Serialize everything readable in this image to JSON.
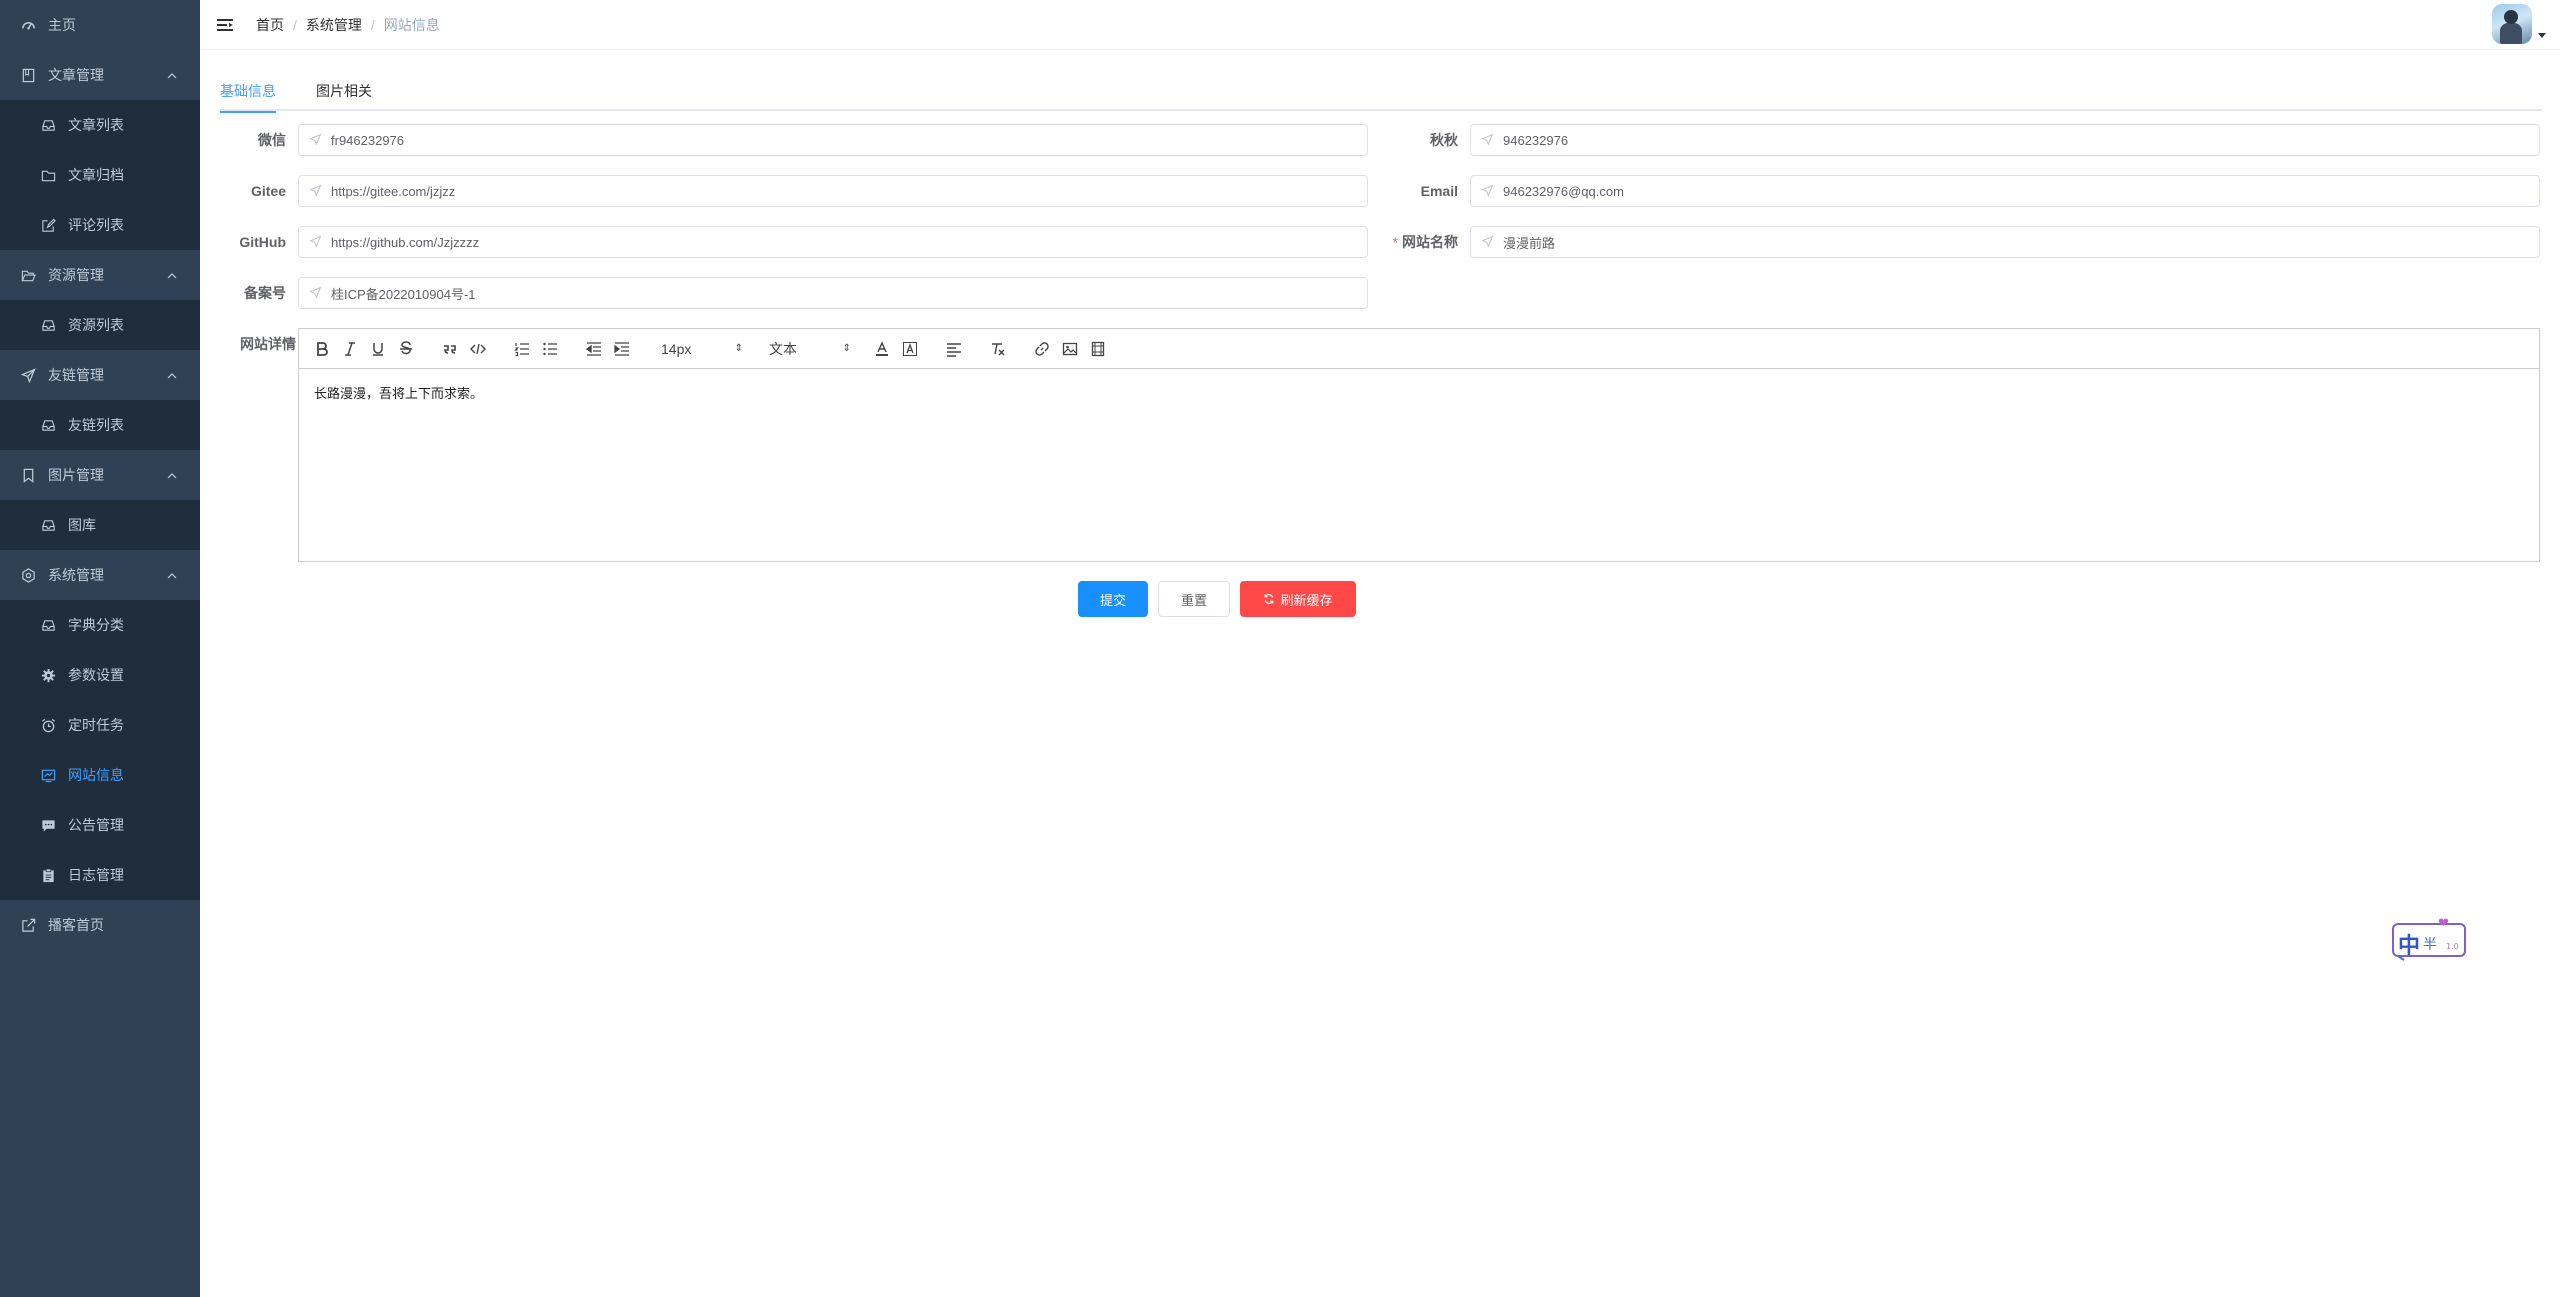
{
  "sidebar": {
    "items": [
      {
        "label": "主页",
        "icon": "dashboard-icon",
        "level": "top"
      },
      {
        "label": "文章管理",
        "icon": "book-icon",
        "level": "top",
        "expandable": true
      },
      {
        "label": "文章列表",
        "icon": "inbox-icon",
        "level": "sub"
      },
      {
        "label": "文章归档",
        "icon": "folder-icon",
        "level": "sub"
      },
      {
        "label": "评论列表",
        "icon": "edit-icon",
        "level": "sub"
      },
      {
        "label": "资源管理",
        "icon": "folder-open-icon",
        "level": "top",
        "expandable": true
      },
      {
        "label": "资源列表",
        "icon": "inbox-icon",
        "level": "sub"
      },
      {
        "label": "友链管理",
        "icon": "send-icon",
        "level": "top",
        "expandable": true
      },
      {
        "label": "友链列表",
        "icon": "inbox-icon",
        "level": "sub"
      },
      {
        "label": "图片管理",
        "icon": "bookmark-icon",
        "level": "top",
        "expandable": true
      },
      {
        "label": "图库",
        "icon": "inbox-icon",
        "level": "sub"
      },
      {
        "label": "系统管理",
        "icon": "settings-icon",
        "level": "top",
        "expandable": true
      },
      {
        "label": "字典分类",
        "icon": "inbox-icon",
        "level": "sub"
      },
      {
        "label": "参数设置",
        "icon": "gear-icon",
        "level": "sub"
      },
      {
        "label": "定时任务",
        "icon": "alarm-clock-icon",
        "level": "sub"
      },
      {
        "label": "网站信息",
        "icon": "monitor-icon",
        "level": "sub",
        "active": true
      },
      {
        "label": "公告管理",
        "icon": "chat-icon",
        "level": "sub"
      },
      {
        "label": "日志管理",
        "icon": "clipboard-icon",
        "level": "sub"
      },
      {
        "label": "播客首页",
        "icon": "external-link-icon",
        "level": "top"
      }
    ]
  },
  "navbar": {
    "breadcrumb": [
      "首页",
      "系统管理",
      "网站信息"
    ],
    "separator": "/"
  },
  "tabs": [
    {
      "label": "基础信息",
      "active": true
    },
    {
      "label": "图片相关",
      "active": false
    }
  ],
  "form": {
    "wechat": {
      "label": "微信",
      "value": "fr946232976"
    },
    "qq": {
      "label": "秋秋",
      "value": "946232976"
    },
    "gitee": {
      "label": "Gitee",
      "value": "https://gitee.com/jzjzz"
    },
    "email": {
      "label": "Email",
      "value": "946232976@qq.com"
    },
    "github": {
      "label": "GitHub",
      "value": "https://github.com/Jzjzzzz"
    },
    "site_name": {
      "label": "网站名称",
      "value": "漫漫前路",
      "required_mark": "*"
    },
    "icp": {
      "label": "备案号",
      "value": "桂ICP备2022010904号-1"
    },
    "details": {
      "label": "网站详情"
    }
  },
  "editor": {
    "font_size": "14px",
    "text_style": "文本",
    "content": "长路漫漫，吾将上下而求索。"
  },
  "buttons": {
    "submit": "提交",
    "reset": "重置",
    "refresh_cache": "刷新缓存"
  },
  "widget": {
    "text": "中",
    "small": "半",
    "tag": "1.0"
  },
  "colors": {
    "sidebar_bg": "#304156",
    "submenu_bg": "#1f2d3d",
    "active": "#409eff",
    "primary_button": "#1890ff",
    "danger_button": "#ff4949"
  }
}
